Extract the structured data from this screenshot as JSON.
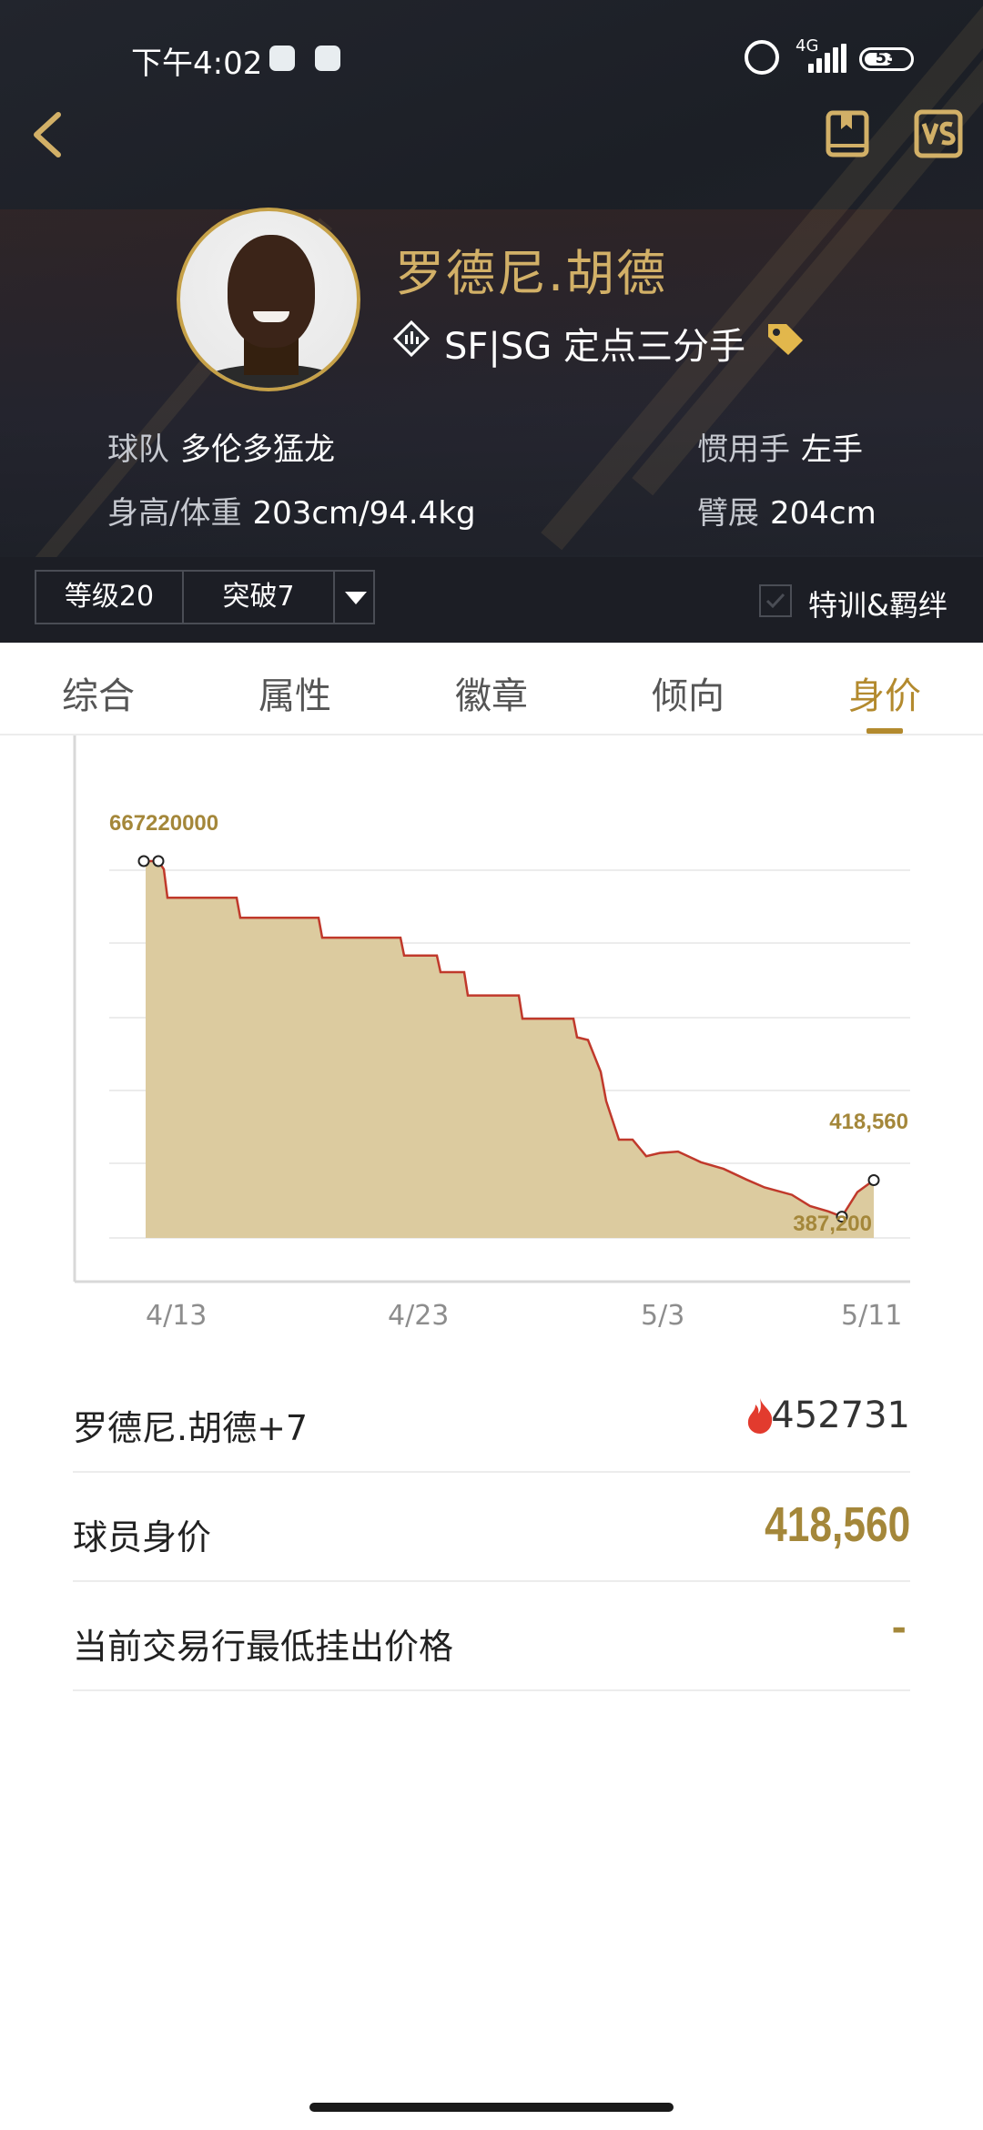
{
  "status_bar": {
    "time": "下午4:02",
    "network": "4G",
    "battery": "53"
  },
  "player": {
    "name": "罗德尼.胡德",
    "position": "SF|SG 定点三分手",
    "team_label": "球队",
    "team": "多伦多猛龙",
    "hand_label": "惯用手",
    "hand": "左手",
    "body_label": "身高/体重",
    "body": "203cm/94.4kg",
    "wingspan_label": "臂展",
    "wingspan": "204cm"
  },
  "controls": {
    "level": "等级20",
    "breakthrough": "突破7",
    "training": "特训&羁绊"
  },
  "tabs": [
    {
      "label": "综合"
    },
    {
      "label": "属性"
    },
    {
      "label": "徽章"
    },
    {
      "label": "倾向"
    },
    {
      "label": "身价"
    }
  ],
  "active_tab": "身价",
  "colors": {
    "gold": "#b38a2e",
    "price_gold": "#a4873a",
    "line_red": "#c0392b",
    "area_fill": "#dccb9f"
  },
  "chart_data": {
    "type": "area",
    "x_ticks": [
      "4/13",
      "4/23",
      "5/3",
      "5/11"
    ],
    "annotations": {
      "max": "667220000",
      "end": "418,560",
      "min": "387,200"
    },
    "series": [
      {
        "values": [
          [
            0,
            667220
          ],
          [
            1.4,
            667220
          ],
          [
            2,
            655000
          ],
          [
            2.4,
            612000
          ],
          [
            10,
            612000
          ],
          [
            10.4,
            582000
          ],
          [
            19,
            582000
          ],
          [
            19.4,
            552000
          ],
          [
            28,
            552000
          ],
          [
            28.4,
            525000
          ],
          [
            32,
            525000
          ],
          [
            32.4,
            500000
          ],
          [
            35,
            500000
          ],
          [
            35.4,
            465000
          ],
          [
            41,
            465000
          ],
          [
            41.4,
            430000
          ],
          [
            47,
            430000
          ],
          [
            47.4,
            402000
          ],
          [
            48.6,
            398000
          ],
          [
            50,
            350000
          ],
          [
            50.6,
            306000
          ],
          [
            52,
            248000
          ],
          [
            53.5,
            248000
          ],
          [
            55,
            223000
          ],
          [
            56.5,
            228000
          ],
          [
            58.5,
            230000
          ],
          [
            61,
            214000
          ],
          [
            63.5,
            204000
          ],
          [
            66,
            188000
          ],
          [
            68,
            176000
          ],
          [
            71,
            165000
          ],
          [
            73,
            148000
          ],
          [
            75,
            140000
          ],
          [
            76.5,
            132000
          ],
          [
            78.2,
            169000
          ],
          [
            80,
            187000
          ]
        ]
      }
    ]
  },
  "rows": {
    "card_name": "罗德尼.胡德+7",
    "heat": "452731",
    "value_label": "球员身价",
    "value": "418,560",
    "min_price_label": "当前交易行最低挂出价格",
    "min_price": "-"
  }
}
